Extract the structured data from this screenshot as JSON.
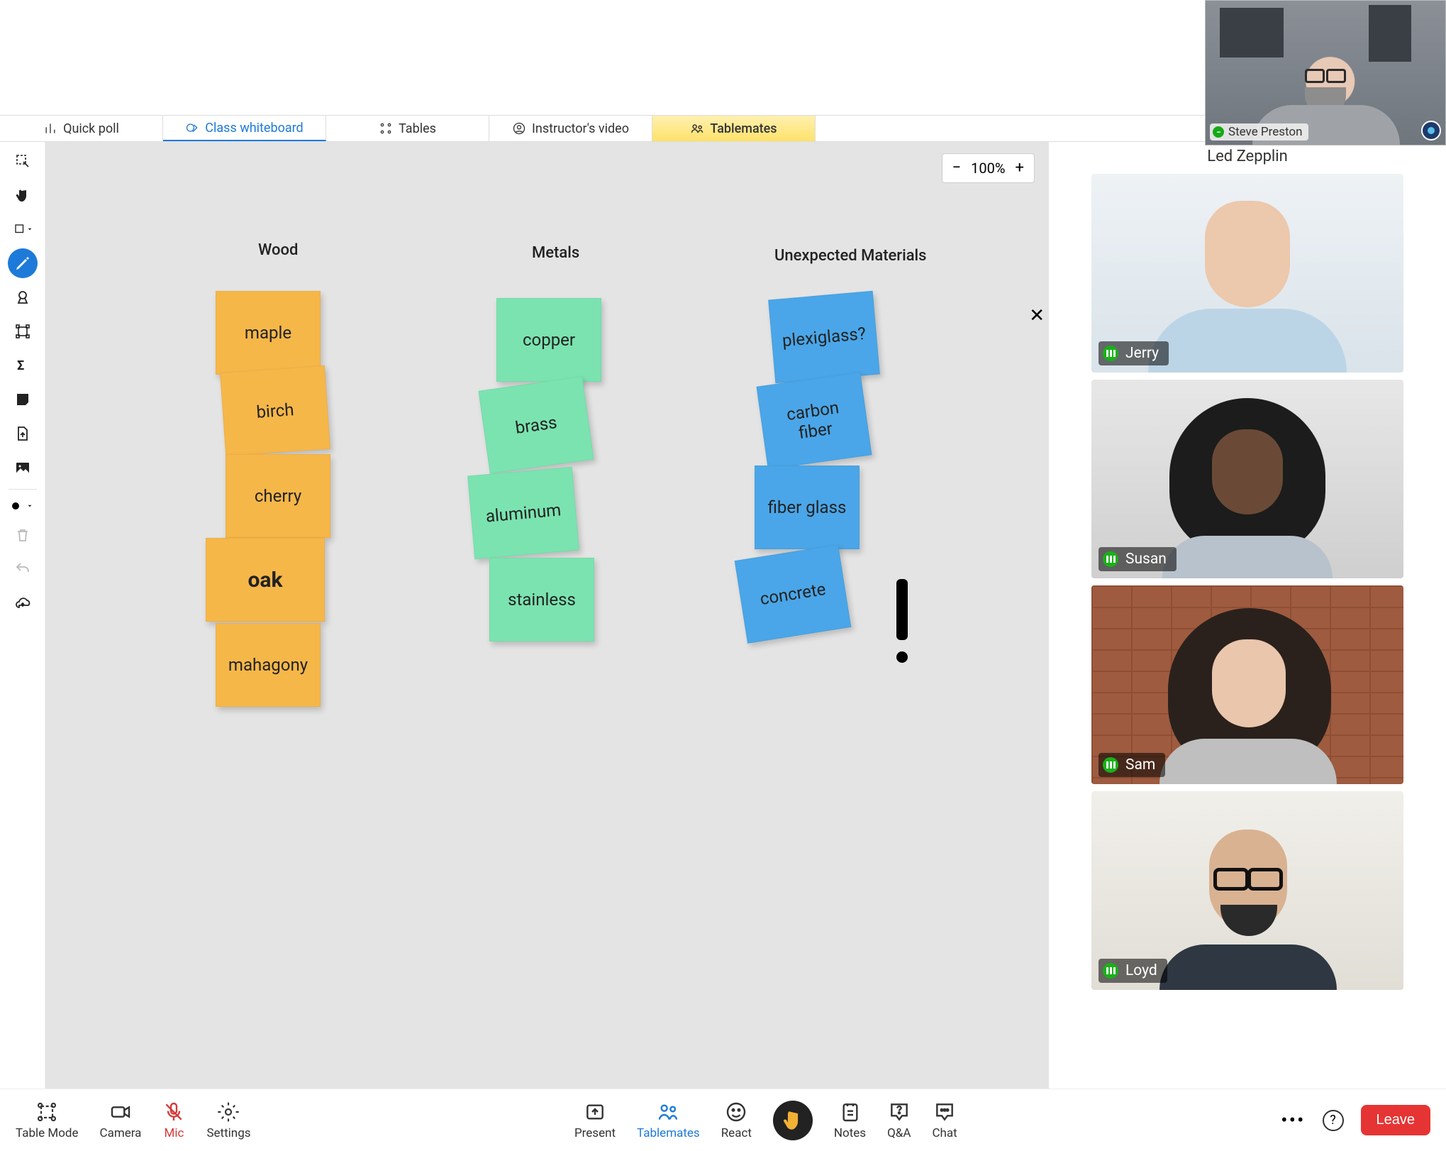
{
  "instructor": {
    "name": "Steve Preston"
  },
  "tabs": [
    {
      "id": "quickpoll",
      "label": "Quick poll"
    },
    {
      "id": "whiteboard",
      "label": "Class whiteboard"
    },
    {
      "id": "tables",
      "label": "Tables"
    },
    {
      "id": "instructorvideo",
      "label": "Instructor's video"
    },
    {
      "id": "tablemates",
      "label": "Tablemates"
    }
  ],
  "zoom": {
    "level": "100%"
  },
  "whiteboard": {
    "columns": {
      "wood": {
        "title": "Wood"
      },
      "metals": {
        "title": "Metals"
      },
      "unexpected": {
        "title": "Unexpected Materials"
      }
    },
    "stickies": {
      "wood": [
        "maple",
        "birch",
        "cherry",
        "oak",
        "mahagony"
      ],
      "metals": [
        "copper",
        "brass",
        "aluminum",
        "stainless"
      ],
      "unexpected": [
        "plexiglass?",
        "carbon fiber",
        "fiber glass",
        "concrete"
      ]
    }
  },
  "tableName": "Led Zepplin",
  "participants": [
    {
      "name": "Jerry"
    },
    {
      "name": "Susan"
    },
    {
      "name": "Sam"
    },
    {
      "name": "Loyd"
    }
  ],
  "bottomBar": {
    "left": {
      "tableMode": "Table Mode",
      "camera": "Camera",
      "mic": "Mic",
      "settings": "Settings"
    },
    "center": {
      "present": "Present",
      "tablemates": "Tablemates",
      "react": "React",
      "notes": "Notes",
      "qa": "Q&A",
      "chat": "Chat"
    },
    "leave": "Leave"
  }
}
